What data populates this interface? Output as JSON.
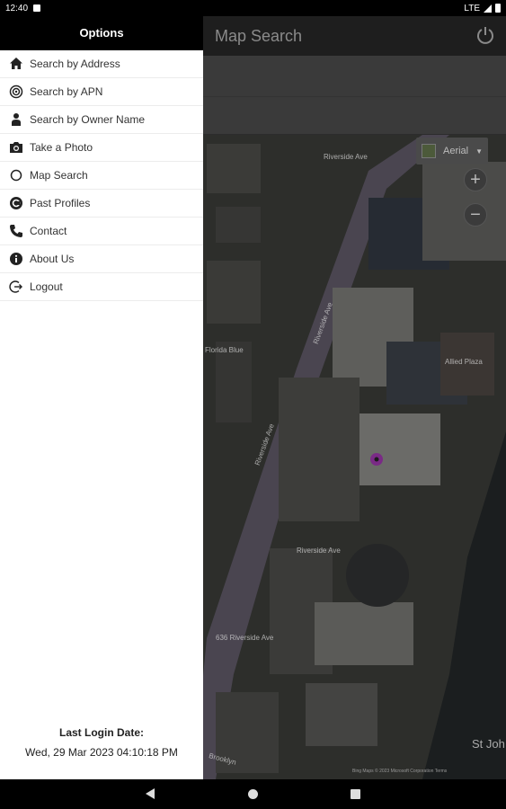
{
  "status_bar": {
    "time": "12:40",
    "network": "LTE"
  },
  "app_bar": {
    "title": "Map Search"
  },
  "map": {
    "layer_button": "Aerial",
    "zoom_in": "+",
    "zoom_out": "−",
    "labels": [
      "Riverside Ave",
      "Riverside Ave",
      "Florida Blue",
      "Riverside Ave",
      "Allied Plaza",
      "Riverside Ave",
      "636 Riverside Ave",
      "Brooklyn"
    ],
    "attribution": "Bing Maps © 2023 Microsoft Corporation  Terms",
    "place": "St Joh"
  },
  "drawer": {
    "header": "Options",
    "items": [
      {
        "label": "Search by Address",
        "icon": "home-icon"
      },
      {
        "label": "Search by APN",
        "icon": "target-icon"
      },
      {
        "label": "Search by Owner Name",
        "icon": "person-icon"
      },
      {
        "label": "Take a Photo",
        "icon": "camera-icon"
      },
      {
        "label": "Map Search",
        "icon": "circle-icon"
      },
      {
        "label": "Past Profiles",
        "icon": "history-icon"
      },
      {
        "label": "Contact",
        "icon": "phone-icon"
      },
      {
        "label": "About Us",
        "icon": "info-icon"
      },
      {
        "label": "Logout",
        "icon": "logout-icon"
      }
    ],
    "login_label": "Last Login Date:",
    "login_value": "Wed, 29 Mar 2023 04:10:18 PM"
  }
}
